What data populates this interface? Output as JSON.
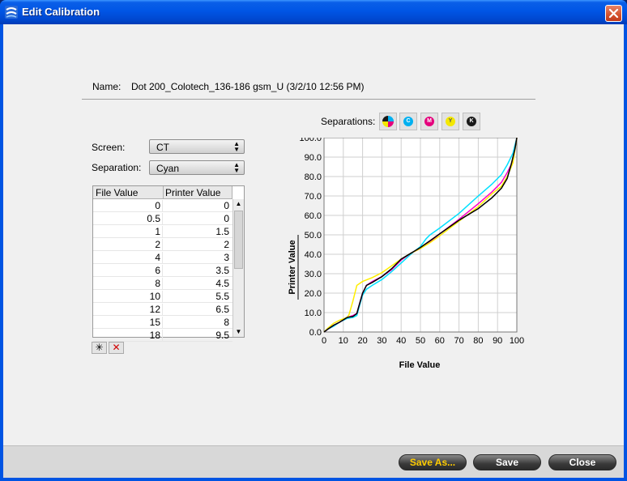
{
  "window": {
    "title": "Edit Calibration"
  },
  "name": {
    "label": "Name:",
    "value": "Dot 200_Colotech_136-186 gsm_U (3/2/10 12:56 PM)"
  },
  "separations": {
    "label": "Separations:",
    "buttons": [
      {
        "id": "all",
        "letter": ""
      },
      {
        "id": "cyan",
        "letter": "C",
        "color": "#00b0f0"
      },
      {
        "id": "magenta",
        "letter": "M",
        "color": "#e4007c"
      },
      {
        "id": "yellow",
        "letter": "Y",
        "color": "#f4e800"
      },
      {
        "id": "black",
        "letter": "K",
        "color": "#1a1a1a"
      }
    ]
  },
  "screen": {
    "label": "Screen:",
    "value": "CT"
  },
  "separation": {
    "label": "Separation:",
    "value": "Cyan"
  },
  "table": {
    "headers": [
      "File Value",
      "Printer Value"
    ],
    "rows": [
      [
        "0",
        "0"
      ],
      [
        "0.5",
        "0"
      ],
      [
        "1",
        "1.5"
      ],
      [
        "2",
        "2"
      ],
      [
        "4",
        "3"
      ],
      [
        "6",
        "3.5"
      ],
      [
        "8",
        "4.5"
      ],
      [
        "10",
        "5.5"
      ],
      [
        "12",
        "6.5"
      ],
      [
        "15",
        "8"
      ],
      [
        "18",
        "9.5"
      ]
    ]
  },
  "buttons": {
    "save_as": "Save As...",
    "save": "Save",
    "close": "Close"
  },
  "colors": {
    "cyan": "#00e0ff",
    "magenta": "#ff00cc",
    "yellow": "#ffee00",
    "black": "#000000",
    "save_as_text": "#ffcc00"
  },
  "chart_data": {
    "type": "line",
    "xlabel": "File Value",
    "ylabel": "Printer Value",
    "xlim": [
      0,
      100
    ],
    "ylim": [
      0,
      100
    ],
    "xticks": [
      "0",
      "10",
      "20",
      "30",
      "40",
      "50",
      "60",
      "70",
      "80",
      "90",
      "100"
    ],
    "yticks": [
      "0.0",
      "10.0",
      "20.0",
      "30.0",
      "40.0",
      "50.0",
      "60.0",
      "70.0",
      "80.0",
      "90.0",
      "100.0"
    ],
    "grid": true,
    "series": [
      {
        "id": "cyan",
        "color": "#00e0ff",
        "x": [
          0,
          2,
          5,
          8,
          12,
          15,
          17,
          18,
          20,
          22,
          25,
          30,
          35,
          40,
          45,
          50,
          53,
          55,
          60,
          70,
          80,
          87,
          92,
          95,
          98,
          100
        ],
        "y": [
          0,
          1.5,
          3,
          5,
          7,
          7.5,
          8.5,
          12,
          19,
          22,
          24,
          27,
          31,
          35.5,
          40,
          44,
          48,
          50,
          53.5,
          61,
          70,
          76,
          81,
          86,
          92,
          100
        ]
      },
      {
        "id": "magenta",
        "color": "#ff00cc",
        "x": [
          0,
          2,
          5,
          8,
          12,
          15,
          17,
          18,
          20,
          22,
          25,
          30,
          35,
          40,
          45,
          50,
          55,
          60,
          70,
          80,
          87,
          92,
          95,
          98,
          100
        ],
        "y": [
          0,
          1.5,
          3.5,
          5,
          7.5,
          8.5,
          9.5,
          13,
          20,
          24,
          26,
          28.5,
          32,
          37,
          40.5,
          43,
          46.5,
          50.5,
          58,
          66,
          72,
          77,
          82,
          88,
          100
        ]
      },
      {
        "id": "yellow",
        "color": "#ffee00",
        "x": [
          0,
          2,
          5,
          8,
          12,
          13,
          15,
          17,
          20,
          25,
          30,
          35,
          40,
          45,
          50,
          55,
          60,
          70,
          80,
          87,
          92,
          95,
          98,
          100
        ],
        "y": [
          0,
          2,
          4.5,
          6,
          7.5,
          9,
          16,
          24,
          26,
          28,
          30.5,
          34,
          37.5,
          40.5,
          43,
          46,
          49.5,
          57,
          64.5,
          71,
          75,
          80,
          87,
          100
        ]
      },
      {
        "id": "black",
        "color": "#000000",
        "x": [
          0,
          2,
          5,
          8,
          12,
          15,
          17,
          18,
          20,
          22,
          25,
          30,
          35,
          40,
          45,
          50,
          55,
          60,
          70,
          80,
          87,
          92,
          95,
          97,
          99,
          100
        ],
        "y": [
          0,
          1.5,
          3.5,
          5,
          7.5,
          8,
          9.5,
          13,
          20,
          24,
          25.5,
          28.5,
          32.5,
          37.5,
          40.5,
          43.5,
          47,
          50.5,
          57.5,
          63.5,
          69,
          74,
          79,
          86,
          94,
          100
        ]
      }
    ]
  }
}
